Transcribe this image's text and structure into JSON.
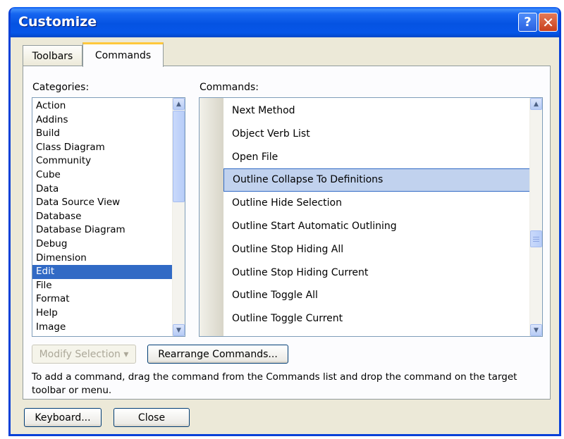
{
  "window": {
    "title": "Customize",
    "help_glyph": "?",
    "close_glyph": "✕"
  },
  "tabs": [
    {
      "label": "Toolbars",
      "selected": false
    },
    {
      "label": "Commands",
      "selected": true
    }
  ],
  "categories": {
    "label": "Categories:",
    "selected": "Edit",
    "items": [
      "Action",
      "Addins",
      "Build",
      "Class Diagram",
      "Community",
      "Cube",
      "Data",
      "Data Source View",
      "Database",
      "Database Diagram",
      "Debug",
      "Dimension",
      "Edit",
      "File",
      "Format",
      "Help",
      "Image"
    ]
  },
  "commands": {
    "label": "Commands:",
    "highlighted": "Outline Collapse To Definitions",
    "items": [
      "Next Method",
      "Object Verb List",
      "Open File",
      "Outline Collapse To Definitions",
      "Outline Hide Selection",
      "Outline Start Automatic Outlining",
      "Outline Stop Hiding All",
      "Outline Stop Hiding Current",
      "Outline Toggle All",
      "Outline Toggle Current"
    ]
  },
  "buttons": {
    "modify_selection": "Modify Selection ▾",
    "rearrange_commands": "Rearrange Commands...",
    "keyboard": "Keyboard...",
    "close": "Close"
  },
  "help_text": "To add a command, drag the command from the Commands list and drop the command on the target toolbar or menu.",
  "colors": {
    "title_bar": "#0553e2",
    "selection": "#316ac5",
    "highlight": "#c1d2ee",
    "dialog_bg": "#ece9d8",
    "active_tab_accent": "#ffc83c"
  }
}
